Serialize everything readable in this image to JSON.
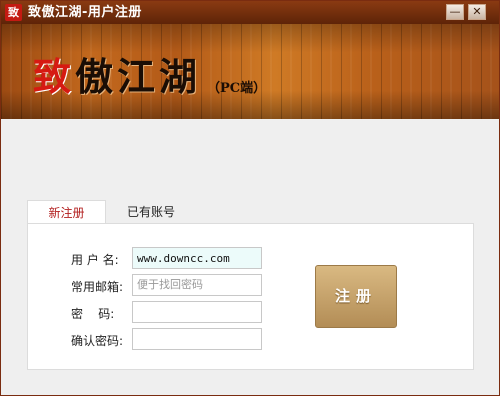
{
  "window": {
    "icon_text": "致",
    "title": "致傲江湖-用户注册",
    "minimize_glyph": "—",
    "close_glyph": "✕"
  },
  "banner": {
    "logo_first_char": "致",
    "logo_rest": "傲江湖",
    "logo_sub": "（PC端）"
  },
  "tabs": {
    "new_label": "新注册",
    "existing_label": "已有账号"
  },
  "form": {
    "username_label": "用 户 名:",
    "username_value": "www.downcc.com",
    "email_label": "常用邮箱:",
    "email_placeholder": "便于找回密码",
    "password_label": "密    码:",
    "confirm_label": "确认密码:",
    "submit_label": "注册"
  },
  "colors": {
    "titlebar": "#6f2c0c",
    "active_tab_text": "#b21e1e",
    "submit_button": "#c4a06a"
  }
}
